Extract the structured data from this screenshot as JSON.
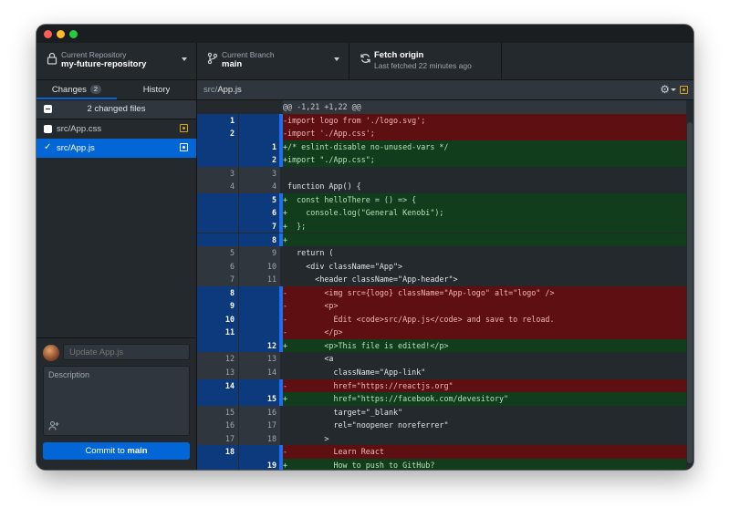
{
  "toolbar": {
    "repo_title": "Current Repository",
    "repo_value": "my-future-repository",
    "branch_title": "Current Branch",
    "branch_value": "main",
    "fetch_title": "Fetch origin",
    "fetch_status": "Last fetched 22 minutes ago"
  },
  "tabs": {
    "changes_label": "Changes",
    "changes_count": "2",
    "history_label": "History"
  },
  "changes": {
    "summary": "2 changed files",
    "files": [
      {
        "path": "src/App.css",
        "selected": false,
        "status": "modified"
      },
      {
        "path": "src/App.js",
        "selected": true,
        "status": "modified"
      }
    ]
  },
  "commit": {
    "summary_placeholder": "Update App.js",
    "description_placeholder": "Description",
    "button_prefix": "Commit to ",
    "button_branch": "main"
  },
  "diff": {
    "file_dir": "src/",
    "file_name": "App.js",
    "lines": [
      {
        "type": "hunk",
        "old": "",
        "new": "",
        "text": "@@ -1,21 +1,22 @@"
      },
      {
        "type": "del",
        "old": "1",
        "new": "",
        "text": "-import logo from './logo.svg';"
      },
      {
        "type": "del",
        "old": "2",
        "new": "",
        "text": "-import './App.css';"
      },
      {
        "type": "add",
        "old": "",
        "new": "1",
        "text": "+/* eslint-disable no-unused-vars */"
      },
      {
        "type": "add",
        "old": "",
        "new": "2",
        "text": "+import \"./App.css\";"
      },
      {
        "type": "ctx",
        "old": "3",
        "new": "3",
        "text": ""
      },
      {
        "type": "ctx",
        "old": "4",
        "new": "4",
        "text": " function App() {"
      },
      {
        "type": "add",
        "old": "",
        "new": "5",
        "text": "+  const helloThere = () => {"
      },
      {
        "type": "add",
        "old": "",
        "new": "6",
        "text": "+    console.log(\"General Kenobi\");"
      },
      {
        "type": "add",
        "old": "",
        "new": "7",
        "text": "+  };"
      },
      {
        "type": "add",
        "old": "",
        "new": "8",
        "text": "+"
      },
      {
        "type": "ctx",
        "old": "5",
        "new": "9",
        "text": "   return ("
      },
      {
        "type": "ctx",
        "old": "6",
        "new": "10",
        "text": "     <div className=\"App\">"
      },
      {
        "type": "ctx",
        "old": "7",
        "new": "11",
        "text": "       <header className=\"App-header\">"
      },
      {
        "type": "del",
        "old": "8",
        "new": "",
        "text": "-        <img src={logo} className=\"App-logo\" alt=\"logo\" />"
      },
      {
        "type": "del",
        "old": "9",
        "new": "",
        "text": "-        <p>"
      },
      {
        "type": "del",
        "old": "10",
        "new": "",
        "text": "-          Edit <code>src/App.js</code> and save to reload."
      },
      {
        "type": "del",
        "old": "11",
        "new": "",
        "text": "-        </p>"
      },
      {
        "type": "add",
        "old": "",
        "new": "12",
        "text": "+        <p>This file is edited!</p>"
      },
      {
        "type": "ctx",
        "old": "12",
        "new": "13",
        "text": "         <a"
      },
      {
        "type": "ctx",
        "old": "13",
        "new": "14",
        "text": "           className=\"App-link\""
      },
      {
        "type": "del",
        "old": "14",
        "new": "",
        "text": "-          href=\"https://reactjs.org\""
      },
      {
        "type": "add",
        "old": "",
        "new": "15",
        "text": "+          href=\"https://facebook.com/devesitory\""
      },
      {
        "type": "ctx",
        "old": "15",
        "new": "16",
        "text": "           target=\"_blank\""
      },
      {
        "type": "ctx",
        "old": "16",
        "new": "17",
        "text": "           rel=\"noopener noreferrer\""
      },
      {
        "type": "ctx",
        "old": "17",
        "new": "18",
        "text": "         >"
      },
      {
        "type": "del",
        "old": "18",
        "new": "",
        "text": "-          Learn React"
      },
      {
        "type": "add",
        "old": "",
        "new": "19",
        "text": "+          How to push to GitHub?"
      }
    ]
  },
  "colors": {
    "accent": "#0366d6",
    "deleted_bg": "#5d0f12",
    "added_bg": "#113d1c",
    "modified_badge": "#d4a31b"
  }
}
